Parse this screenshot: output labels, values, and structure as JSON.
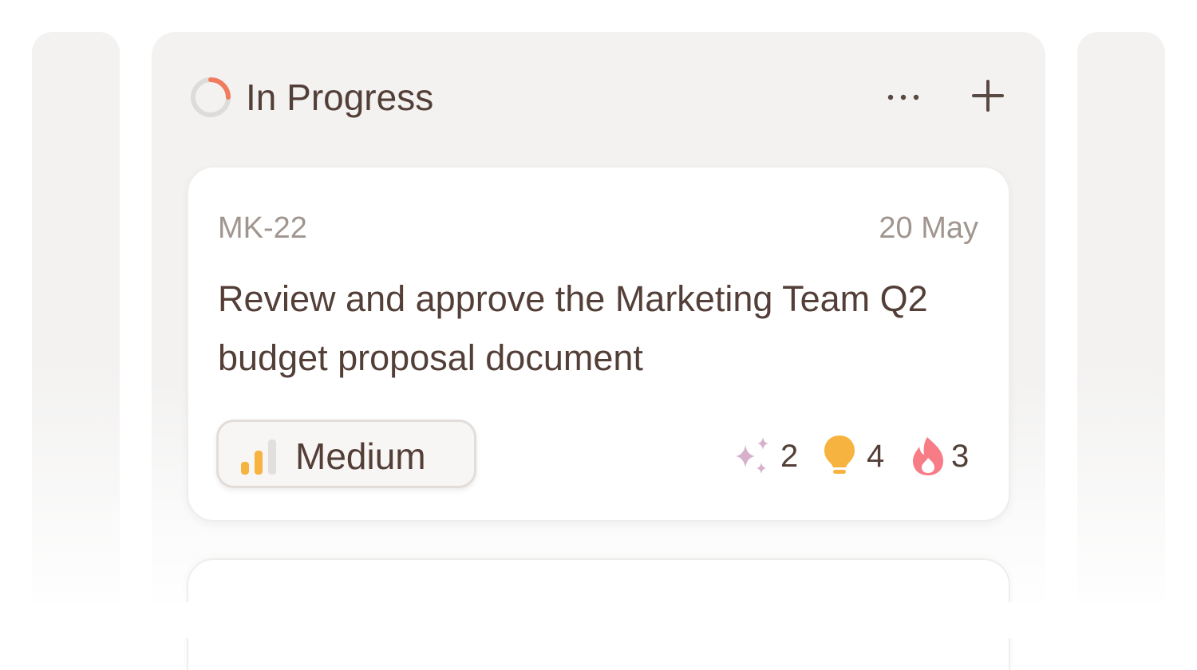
{
  "column": {
    "title": "In Progress",
    "status_icon": "progress-ring-icon",
    "accent_color": "#f07b5e",
    "actions": {
      "more": "more-horizontal-icon",
      "add": "plus-icon"
    }
  },
  "card": {
    "id": "MK-22",
    "date": "20 May",
    "title": "Review and approve the Marketing Team Q2 budget proposal document",
    "priority": {
      "label": "Medium",
      "icon": "signal-bars-icon",
      "color": "#f6b33f",
      "level": 2,
      "max_level": 3
    },
    "stats": [
      {
        "icon": "sparkles-icon",
        "count": "2",
        "color": "#d7b1cc"
      },
      {
        "icon": "lightbulb-icon",
        "count": "4",
        "color": "#f6b33f"
      },
      {
        "icon": "fire-icon",
        "count": "3",
        "color": "#f77c86"
      }
    ]
  }
}
